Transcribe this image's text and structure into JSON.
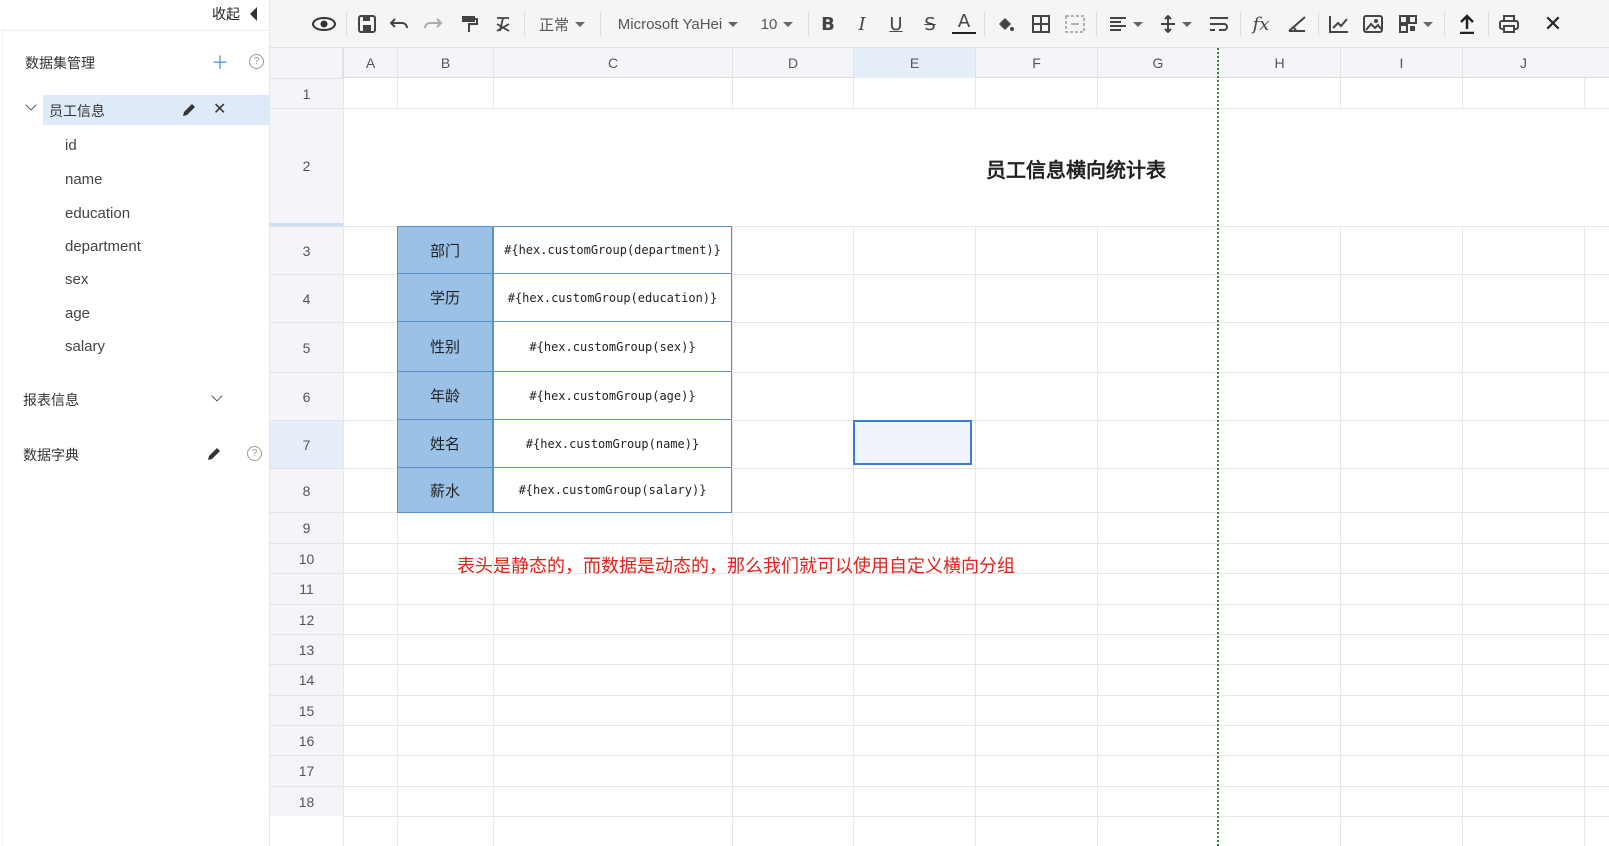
{
  "left_panel": {
    "collapse_label": "收起",
    "dataset_management_title": "数据集管理",
    "dataset": {
      "name": "员工信息",
      "fields": [
        "id",
        "name",
        "education",
        "department",
        "sex",
        "age",
        "salary"
      ]
    },
    "report_info_title": "报表信息",
    "dictionary_title": "数据字典",
    "help_symbol": "?"
  },
  "toolbar": {
    "style_select": "正常",
    "font_select": "Microsoft YaHei",
    "size_select": "10",
    "fx_label": "fx"
  },
  "sheet": {
    "columns": [
      "A",
      "B",
      "C",
      "D",
      "E",
      "F",
      "G",
      "H",
      "I",
      "J"
    ],
    "rows": [
      "1",
      "2",
      "3",
      "4",
      "5",
      "6",
      "7",
      "8",
      "9",
      "10",
      "11",
      "12",
      "13",
      "14",
      "15",
      "16",
      "17",
      "18"
    ],
    "title": "员工信息横向统计表",
    "table": [
      {
        "label": "部门",
        "expr": "#{hex.customGroup(department)}"
      },
      {
        "label": "学历",
        "expr": "#{hex.customGroup(education)}"
      },
      {
        "label": "性别",
        "expr": "#{hex.customGroup(sex)}"
      },
      {
        "label": "年龄",
        "expr": "#{hex.customGroup(age)}"
      },
      {
        "label": "姓名",
        "expr": "#{hex.customGroup(name)}"
      },
      {
        "label": "薪水",
        "expr": "#{hex.customGroup(salary)}"
      }
    ],
    "note": "表头是静态的，而数据是动态的，那么我们就可以使用自定义横向分组"
  }
}
